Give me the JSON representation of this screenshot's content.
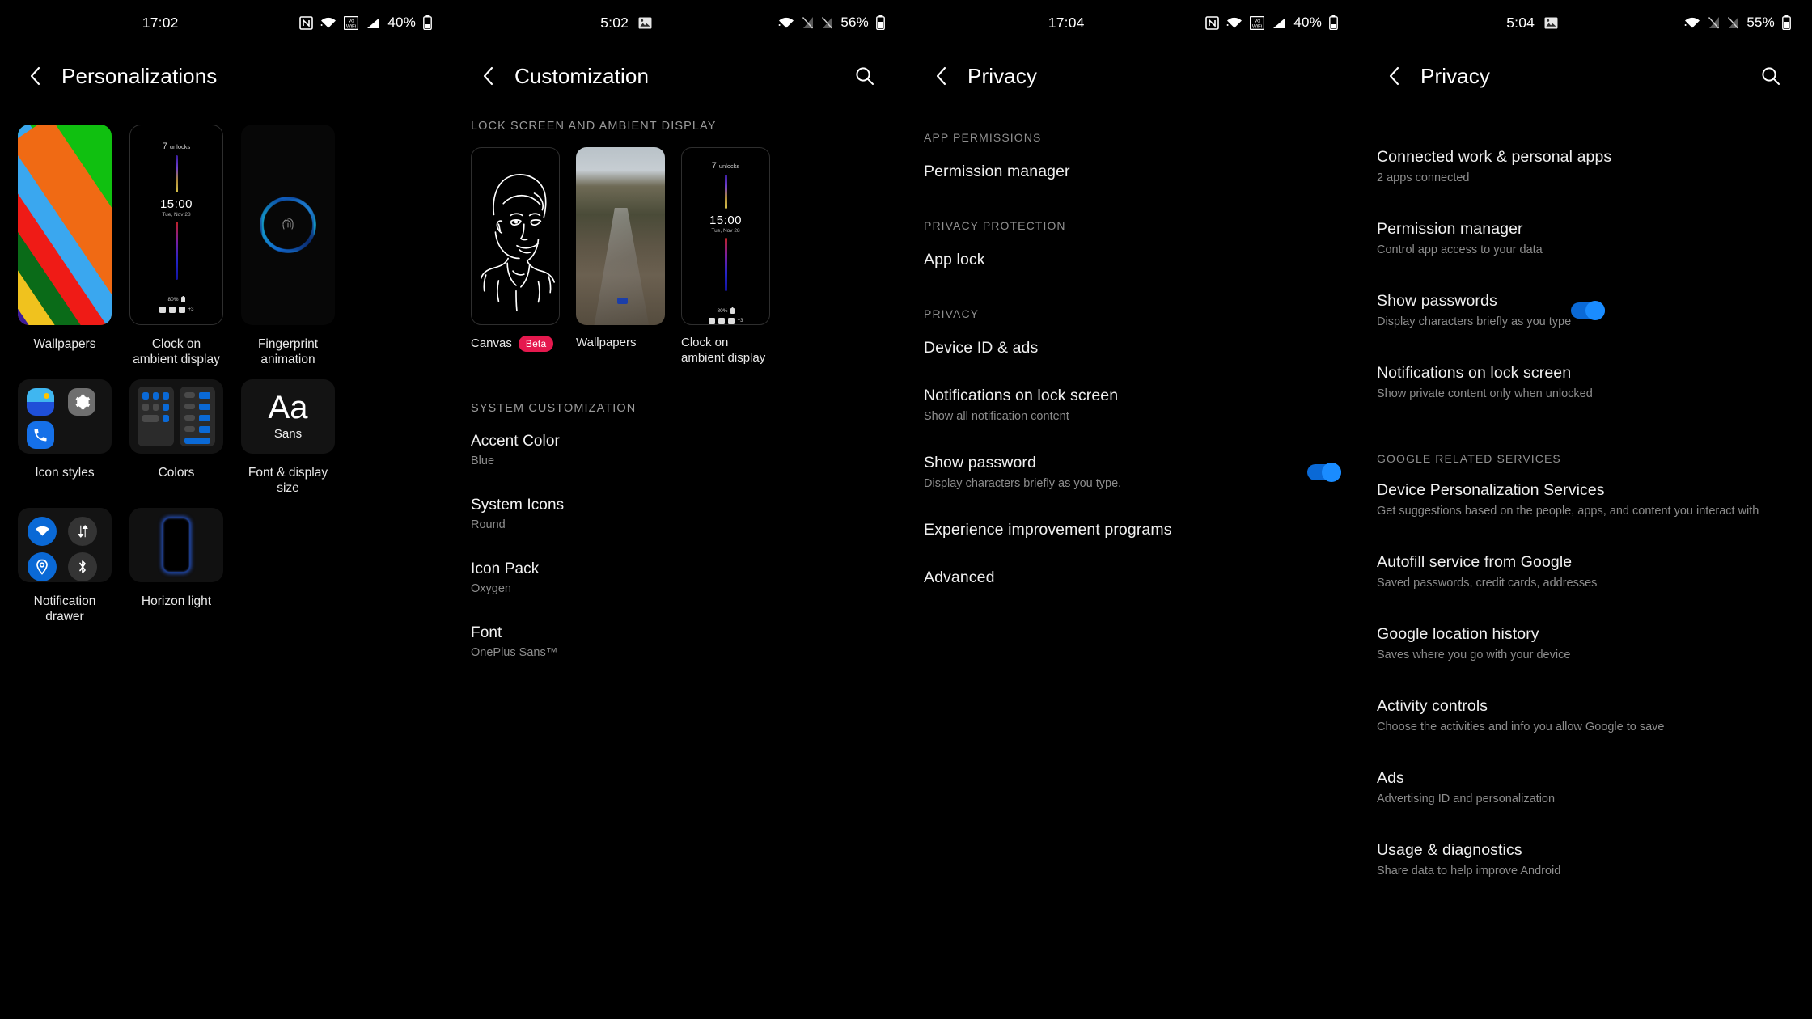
{
  "screens": [
    {
      "id": "personalizations",
      "status": {
        "time": "17:02",
        "battery": "40%",
        "icons": [
          "nfc-icon",
          "wifi-icon",
          "volte-wifi-icon",
          "signal-icon",
          "battery-icon"
        ]
      },
      "appbar": {
        "title": "Personalizations",
        "back": "back-icon"
      },
      "tiles": [
        {
          "label": "Wallpapers",
          "kind": "wallpaper"
        },
        {
          "label": "Clock on ambient display",
          "kind": "ambient-clock",
          "aod": {
            "unlocks_count": "7",
            "unlocks_label": "unlocks",
            "time": "15:00",
            "date": "Tue, Nov 28",
            "battery": "80%",
            "extra_apps": "+3"
          }
        },
        {
          "label": "Fingerprint animation",
          "kind": "fingerprint"
        },
        {
          "label": "Icon styles",
          "kind": "icon-styles"
        },
        {
          "label": "Colors",
          "kind": "colors"
        },
        {
          "label": "Font & display size",
          "kind": "font",
          "aa": "Aa",
          "font_name": "Sans"
        },
        {
          "label": "Notification drawer",
          "kind": "notification-drawer"
        },
        {
          "label": "Horizon light",
          "kind": "horizon-light"
        }
      ]
    },
    {
      "id": "customization",
      "status": {
        "time": "5:02",
        "battery": "56%",
        "icons": [
          "image-icon",
          "wifi-icon",
          "signal-off-icon",
          "signal-off-icon",
          "battery-icon"
        ]
      },
      "appbar": {
        "title": "Customization",
        "back": "back-icon",
        "search": "search-icon"
      },
      "section_lock": "LOCK SCREEN AND AMBIENT DISPLAY",
      "lock_tiles": [
        {
          "label": "Canvas",
          "badge": "Beta",
          "kind": "canvas"
        },
        {
          "label": "Wallpapers",
          "badge": "",
          "kind": "photo"
        },
        {
          "label": "Clock on ambient display",
          "badge": "",
          "kind": "ambient-clock",
          "aod": {
            "unlocks_count": "7",
            "unlocks_label": "unlocks",
            "time": "15:00",
            "date": "Tue, Nov 28",
            "battery": "80%",
            "extra_apps": "+3"
          }
        }
      ],
      "section_system": "SYSTEM CUSTOMIZATION",
      "system_items": [
        {
          "title": "Accent Color",
          "sub": "Blue"
        },
        {
          "title": "System Icons",
          "sub": "Round"
        },
        {
          "title": "Icon Pack",
          "sub": "Oxygen"
        },
        {
          "title": "Font",
          "sub": "OnePlus Sans™"
        }
      ]
    },
    {
      "id": "privacy-a",
      "status": {
        "time": "17:04",
        "battery": "40%",
        "icons": [
          "nfc-icon",
          "wifi-icon",
          "volte-wifi-icon",
          "signal-icon",
          "battery-icon"
        ]
      },
      "appbar": {
        "title": "Privacy",
        "back": "back-icon"
      },
      "groups": [
        {
          "header": "APP PERMISSIONS",
          "items": [
            {
              "title": "Permission manager",
              "sub": "",
              "toggle": null
            }
          ]
        },
        {
          "header": "PRIVACY PROTECTION",
          "items": [
            {
              "title": "App lock",
              "sub": "",
              "toggle": null
            }
          ]
        },
        {
          "header": "PRIVACY",
          "items": [
            {
              "title": "Device ID & ads",
              "sub": "",
              "toggle": null
            },
            {
              "title": "Notifications on lock screen",
              "sub": "Show all notification content",
              "toggle": null
            },
            {
              "title": "Show password",
              "sub": "Display characters briefly as you type.",
              "toggle": "on"
            },
            {
              "title": "Experience improvement programs",
              "sub": "",
              "toggle": null
            },
            {
              "title": "Advanced",
              "sub": "",
              "toggle": null
            }
          ]
        }
      ]
    },
    {
      "id": "privacy-b",
      "status": {
        "time": "5:04",
        "battery": "55%",
        "icons": [
          "image-icon",
          "wifi-icon",
          "signal-off-icon",
          "signal-off-icon",
          "battery-icon"
        ]
      },
      "appbar": {
        "title": "Privacy",
        "back": "back-icon",
        "search": "search-icon"
      },
      "groups": [
        {
          "header": "",
          "items": [
            {
              "title": "Connected work & personal apps",
              "sub": "2 apps connected",
              "toggle": null
            },
            {
              "title": "Permission manager",
              "sub": "Control app access to your data",
              "toggle": null
            },
            {
              "title": "Show passwords",
              "sub": "Display characters briefly as you type",
              "toggle": "on"
            },
            {
              "title": "Notifications on lock screen",
              "sub": "Show private content only when unlocked",
              "toggle": null
            }
          ]
        },
        {
          "header": "GOOGLE RELATED SERVICES",
          "items": [
            {
              "title": "Device Personalization Services",
              "sub": "Get suggestions based on the people, apps, and content you interact with",
              "toggle": null
            },
            {
              "title": "Autofill service from Google",
              "sub": "Saved passwords, credit cards, addresses",
              "toggle": null
            },
            {
              "title": "Google location history",
              "sub": "Saves where you go with your device",
              "toggle": null
            },
            {
              "title": "Activity controls",
              "sub": "Choose the activities and info you allow Google to save",
              "toggle": null
            },
            {
              "title": "Ads",
              "sub": "Advertising ID and personalization",
              "toggle": null
            },
            {
              "title": "Usage & diagnostics",
              "sub": "Share data to help improve Android",
              "toggle": null
            }
          ]
        }
      ]
    }
  ],
  "colors": {
    "accent": "#0a69d6",
    "accent_light": "#1a8cff",
    "badge": "#e5194e",
    "background": "#000000",
    "text": "#ffffff",
    "subtext": "#8c8c8c"
  }
}
